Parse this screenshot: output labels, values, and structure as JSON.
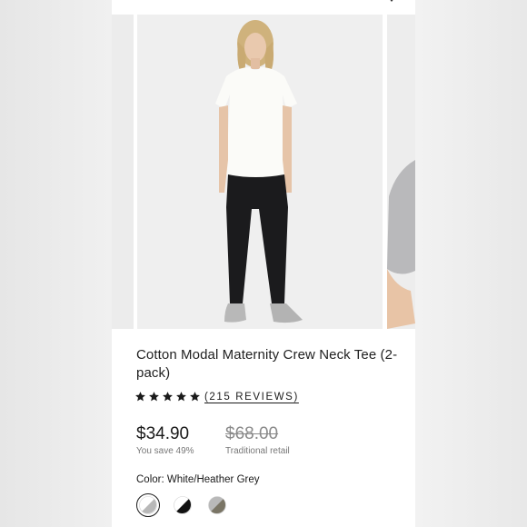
{
  "product": {
    "title": "Cotton Modal Maternity Crew Neck Tee (2-pack)",
    "rating": {
      "stars": 5,
      "reviews_text": "(215 REVIEWS)"
    },
    "price": "$34.90",
    "savings": "You save 49%",
    "original_price": "$68.00",
    "original_label": "Traditional retail",
    "color_label": "Color: White/Heather Grey",
    "swatches": [
      {
        "name": "white-heather-grey",
        "selected": true
      },
      {
        "name": "black-white",
        "selected": false
      },
      {
        "name": "heather-grey-olive",
        "selected": false
      }
    ]
  },
  "colors": {
    "text": "#1a1a1a",
    "muted": "#777777",
    "strikethrough": "#8a8a8a",
    "photo_bg": "#efefef"
  },
  "icons": [
    "chevron-icon",
    "star-icon"
  ]
}
